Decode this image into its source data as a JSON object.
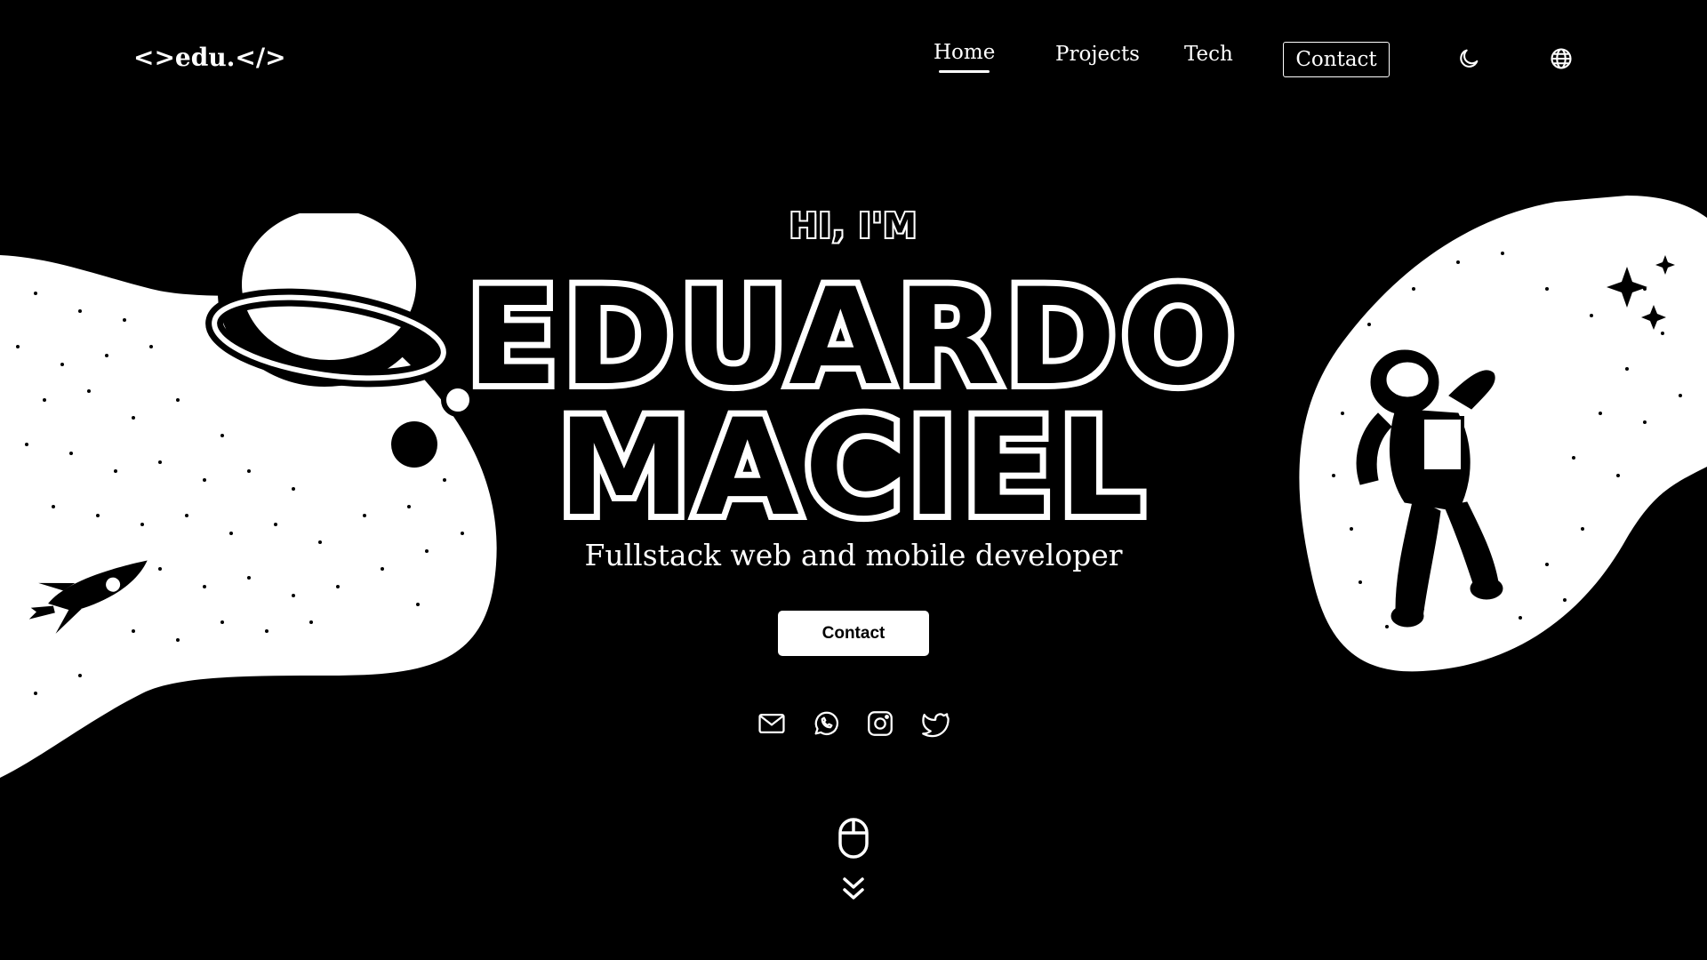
{
  "nav": {
    "logo": "<>edu.</>",
    "links": [
      {
        "label": "Home",
        "active": true
      },
      {
        "label": "Projects",
        "active": false
      },
      {
        "label": "Tech",
        "active": false
      }
    ],
    "contact_label": "Contact",
    "theme_icon": "moon-icon",
    "language_icon": "globe-icon"
  },
  "hero": {
    "greeting": "HI, I'M",
    "name_first": "EDUARDO",
    "name_last": "MACIEL",
    "subtitle": "Fullstack web and mobile developer",
    "cta_label": "Contact"
  },
  "social": [
    "mail-icon",
    "whatsapp-icon",
    "instagram-icon",
    "twitter-icon"
  ],
  "scroll": {
    "icons": [
      "mouse-icon",
      "chevrons-down-icon"
    ]
  },
  "colors": {
    "background": "#000000",
    "foreground": "#ffffff"
  }
}
